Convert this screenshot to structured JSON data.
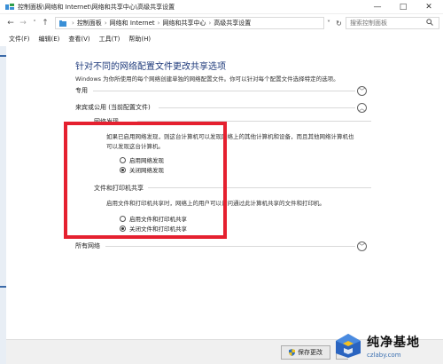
{
  "window": {
    "title": "控制面板\\网络和 Internet\\网络和共享中心\\高级共享设置",
    "controls": {
      "minimize": "—",
      "maximize": "□",
      "close": "✕"
    }
  },
  "nav": {
    "back": "←",
    "forward": "→",
    "history": "˅",
    "up": "↑"
  },
  "address": {
    "crumbs": [
      "控制面板",
      "网络和 Internet",
      "网络和共享中心",
      "高级共享设置"
    ],
    "separator": "›",
    "dropdown": "˅",
    "refresh": "↻"
  },
  "search": {
    "placeholder": "搜索控制面板"
  },
  "menu": [
    "文件(F)",
    "编辑(E)",
    "查看(V)",
    "工具(T)",
    "帮助(H)"
  ],
  "page": {
    "title": "针对不同的网络配置文件更改共享选项",
    "description": "Windows 为你所使用的每个网络创建单独的网络配置文件。你可以针对每个配置文件选择特定的选项。"
  },
  "sections": {
    "private": {
      "label": "专用",
      "state": "collapsed"
    },
    "guest": {
      "label": "来宾或公用 (当前配置文件)",
      "state": "expanded"
    },
    "all": {
      "label": "所有网络",
      "state": "collapsed"
    }
  },
  "network_discovery": {
    "heading": "网络发现",
    "desc_line1": "如果已启用网络发现，则这台计算机可以发现网络上的其他计算机和设备，而且其他网络计算机也",
    "desc_line2": "可以发现这台计算机。",
    "options": [
      "启用网络发现",
      "关闭网络发现"
    ],
    "selected": "关闭网络发现"
  },
  "file_printer_sharing": {
    "heading": "文件和打印机共享",
    "desc": "启用文件和打印机共享时，网络上的用户可以访问通过此计算机共享的文件和打印机。",
    "options": [
      "启用文件和打印机共享",
      "关闭文件和打印机共享"
    ],
    "selected": "关闭文件和打印机共享"
  },
  "footer": {
    "save_label": "保存更改"
  },
  "watermark": {
    "title": "纯净基地",
    "url": "czlaby.com"
  },
  "colors": {
    "title_blue": "#1e3a7b",
    "highlight_red": "#e5202f"
  },
  "icons": {
    "app": "control-panel-icon",
    "search": "magnifier",
    "chevron_up": "︿",
    "chevron_down": "﹀",
    "shield": "uac-shield-icon"
  }
}
